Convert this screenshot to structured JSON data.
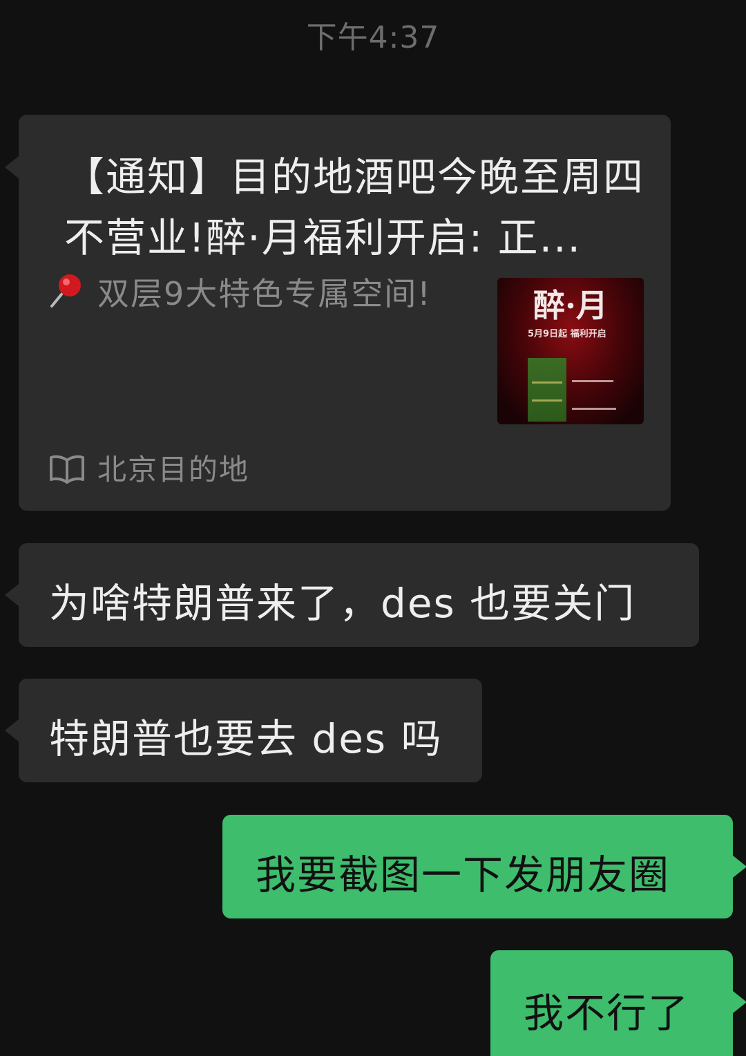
{
  "timestamp": "下午4:37",
  "link_card": {
    "title": "【通知】目的地酒吧今晚至周四不营业!醉·月福利开启: 正...",
    "description": "双层9大特色专属空间!",
    "source": "北京目的地",
    "thumbnail": {
      "title": "醉·月",
      "subtitle": "5月9日起 福利开启"
    },
    "pin_icon": "pushpin-icon",
    "source_icon": "book-icon"
  },
  "messages": [
    {
      "direction": "incoming",
      "text": "为啥特朗普来了，des 也要关门"
    },
    {
      "direction": "incoming",
      "text": "特朗普也要去 des 吗"
    },
    {
      "direction": "outgoing",
      "text": "我要截图一下发朋友圈"
    },
    {
      "direction": "outgoing",
      "text": "我不行了"
    }
  ],
  "colors": {
    "background": "#111111",
    "incoming_bubble": "#2c2c2c",
    "outgoing_bubble": "#3ebd6d",
    "timestamp": "#6d6d6d"
  }
}
